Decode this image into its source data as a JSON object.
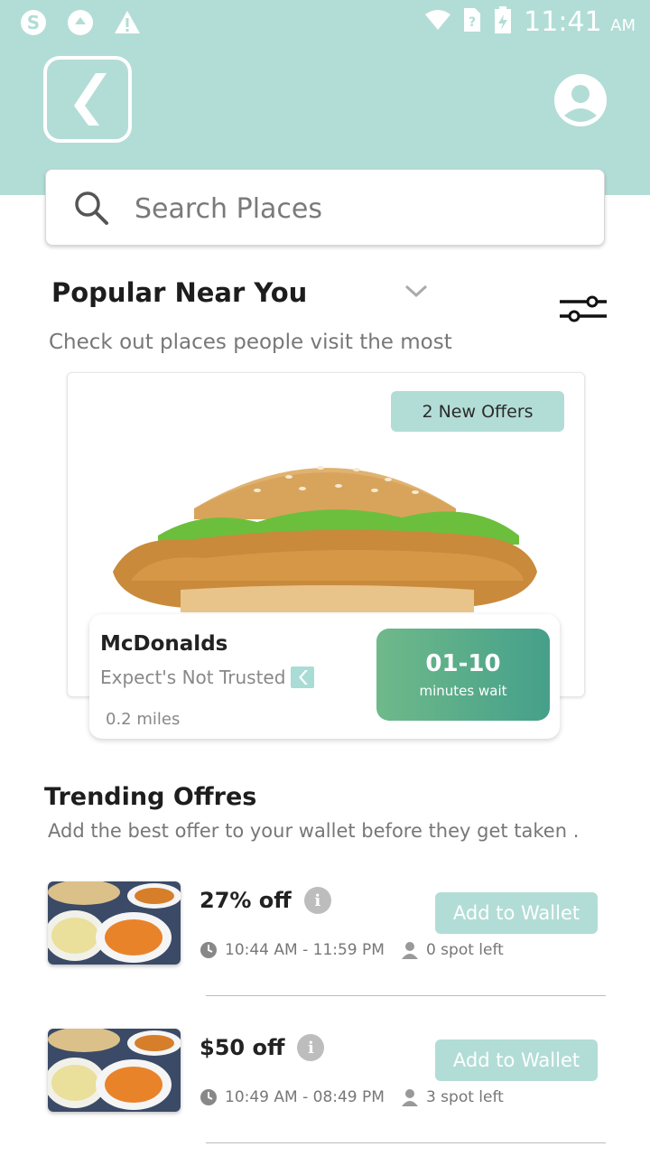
{
  "status_bar": {
    "time": "11:41",
    "ampm": "AM",
    "icons": [
      "skype-icon",
      "sync-icon",
      "warning-icon",
      "wifi-icon",
      "sim-unknown-icon",
      "battery-icon"
    ]
  },
  "header": {
    "logo_icon": "chevron-logo-icon",
    "profile_icon": "account-circle-icon"
  },
  "search": {
    "placeholder": "Search Places"
  },
  "popular": {
    "title": "Popular Near You",
    "subtitle": "Check out places people visit the most",
    "featured": {
      "offers_badge": "2 New Offers",
      "name": "McDonalds",
      "trust_label": "Expect's Not Trusted",
      "distance": "0.2 miles",
      "wait_time": "01-10",
      "wait_label": "minutes wait"
    }
  },
  "trending": {
    "title": "Trending Offres",
    "subtitle": "Add the best offer to your wallet before they get taken .",
    "offers": [
      {
        "title": "27% off",
        "time": "10:44 AM - 11:59 PM",
        "spots": "0 spot left",
        "button": "Add to Wallet"
      },
      {
        "title": "$50 off",
        "time": "10:49 AM - 08:49 PM",
        "spots": "3 spot left",
        "button": "Add to Wallet"
      }
    ]
  },
  "colors": {
    "header": "#b2ddd6",
    "accent": "#b2ddd6",
    "wait_start": "#6fb98a",
    "wait_end": "#45a08a"
  }
}
